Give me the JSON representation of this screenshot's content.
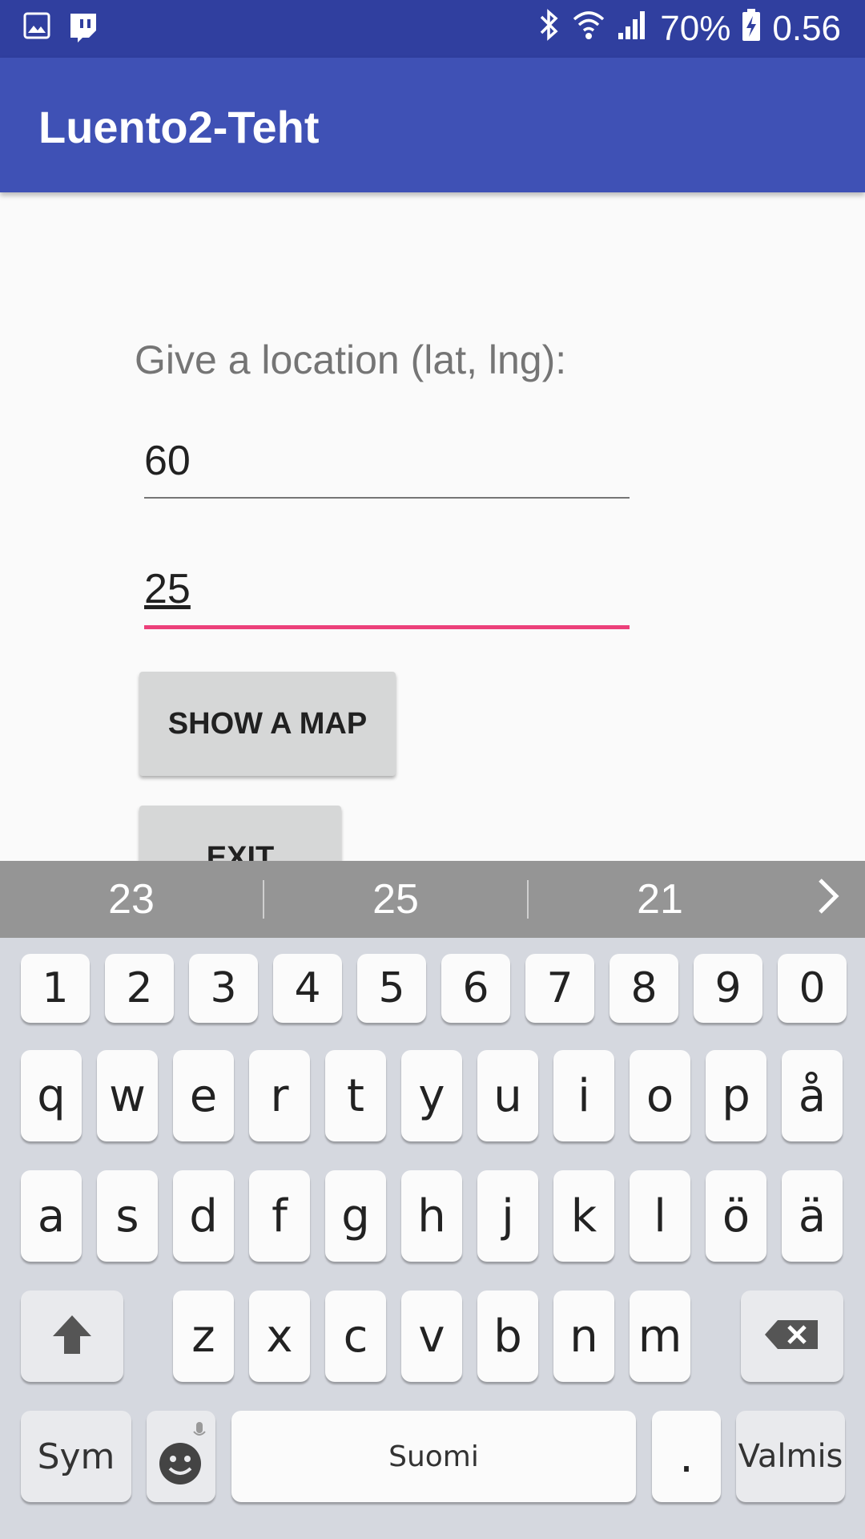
{
  "status_bar": {
    "battery": "70%",
    "time": "0.56",
    "icons": [
      "gallery-icon",
      "twitch-icon",
      "bluetooth-icon",
      "wifi-icon",
      "signal-icon",
      "battery-charging-icon"
    ]
  },
  "app_bar": {
    "title": "Luento2-Teht"
  },
  "form": {
    "prompt": "Give a location (lat, lng):",
    "lat_value": "60",
    "lng_value": "25",
    "show_map_label": "SHOW A MAP",
    "exit_label": "EXIT"
  },
  "suggestions": [
    "23",
    "25",
    "21"
  ],
  "keyboard": {
    "number_row": [
      "1",
      "2",
      "3",
      "4",
      "5",
      "6",
      "7",
      "8",
      "9",
      "0"
    ],
    "row1": [
      "q",
      "w",
      "e",
      "r",
      "t",
      "y",
      "u",
      "i",
      "o",
      "p",
      "å"
    ],
    "row2": [
      "a",
      "s",
      "d",
      "f",
      "g",
      "h",
      "j",
      "k",
      "l",
      "ö",
      "ä"
    ],
    "row3": [
      "z",
      "x",
      "c",
      "v",
      "b",
      "n",
      "m"
    ],
    "sym_label": "Sym",
    "space_label": "Suomi",
    "period_label": ".",
    "done_label": "Valmis"
  },
  "colors": {
    "status_bar": "#303f9f",
    "app_bar": "#3f51b5",
    "accent": "#ec407a"
  }
}
